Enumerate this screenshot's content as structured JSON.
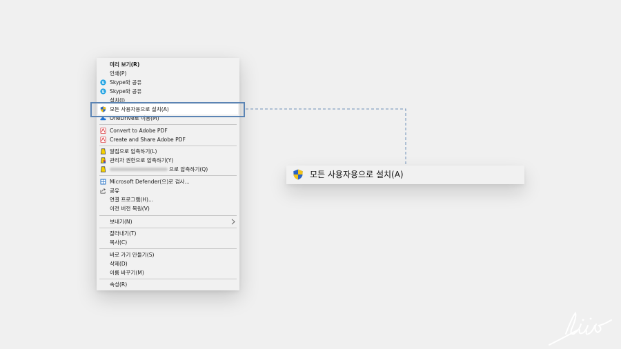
{
  "context_menu": {
    "items": [
      {
        "label": "미리 보기(R)",
        "icon": "",
        "bold": true
      },
      {
        "label": "인쇄(P)",
        "icon": ""
      },
      {
        "label": "Skype와 공유",
        "icon": "skype-icon"
      },
      {
        "label": "Skype와 공유",
        "icon": "skype-icon"
      },
      {
        "label": "설치(I)",
        "icon": ""
      },
      {
        "label": "모든 사용자용으로 설치(A)",
        "icon": "uac-shield-icon",
        "highlighted": true
      },
      {
        "label": "OneDrive로 이동(M)",
        "icon": "onedrive-icon"
      },
      {
        "label": "Convert to Adobe PDF",
        "icon": "adobe-pdf-icon"
      },
      {
        "label": "Create and Share Adobe PDF",
        "icon": "adobe-pdf-icon"
      },
      {
        "label": "알집으로 압축하기(L)",
        "icon": "alzip-icon"
      },
      {
        "label": "관리자 권한으로 압축하기(Y)",
        "icon": "alzip-admin-icon"
      },
      {
        "label": "으로 압축하기(Q)",
        "icon": "alzip-icon",
        "blurred_prefix": true
      },
      {
        "label": "Microsoft Defender(으)로 검사...",
        "icon": "defender-icon"
      },
      {
        "label": "공유",
        "icon": "share-icon"
      },
      {
        "label": "연결 프로그램(H)...",
        "icon": ""
      },
      {
        "label": "이전 버전 복원(V)",
        "icon": ""
      },
      {
        "label": "보내기(N)",
        "icon": "",
        "submenu": true
      },
      {
        "label": "잘라내기(T)",
        "icon": ""
      },
      {
        "label": "복사(C)",
        "icon": ""
      },
      {
        "label": "바로 가기 만들기(S)",
        "icon": ""
      },
      {
        "label": "삭제(D)",
        "icon": ""
      },
      {
        "label": "이름 바꾸기(M)",
        "icon": ""
      },
      {
        "label": "속성(R)",
        "icon": ""
      }
    ]
  },
  "zoom_callout": {
    "label": "모든 사용자용으로 설치(A)",
    "icon": "uac-shield-icon"
  },
  "colors": {
    "highlight_border": "#5b84b4",
    "connector": "#6d8fb8",
    "skype": "#1da1e2",
    "shield_blue": "#2b63c4",
    "shield_yellow": "#f2c318",
    "pdf_red": "#d8262b",
    "alzip_yellow": "#f5d000"
  },
  "watermark": {
    "type": "handwritten-signature"
  }
}
